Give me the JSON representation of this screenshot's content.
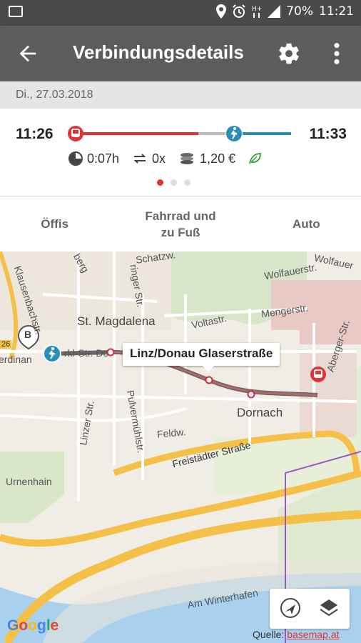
{
  "status_bar": {
    "battery": "70%",
    "time": "11:21",
    "icons": [
      "image-icon",
      "location-icon",
      "alarm-icon",
      "network-hplus-icon",
      "signal-icon"
    ]
  },
  "app_bar": {
    "title": "Verbindungsdetails",
    "icons": [
      "back-arrow-icon",
      "gear-icon",
      "more-vert-icon"
    ]
  },
  "date": "Di., 27.03.2018",
  "connection": {
    "departure": "11:26",
    "arrival": "11:33",
    "duration": "0:07h",
    "transfers": "0x",
    "price": "1,20 €",
    "icons": [
      "tram-icon",
      "walk-icon",
      "clock-icon",
      "transfer-icon",
      "coins-icon",
      "leaf-icon"
    ],
    "page_count": 3,
    "active_page": 0,
    "colors": {
      "tram": "#e03535",
      "walk": "#2a8fb8",
      "leaf": "#3aa845"
    }
  },
  "tabs": [
    {
      "label_lines": [
        "Öffis"
      ]
    },
    {
      "label_lines": [
        "Fahrrad und",
        "zu Fuß"
      ]
    },
    {
      "label_lines": [
        "Auto"
      ]
    }
  ],
  "map": {
    "callout": "Linz/Donau Glaserstraße",
    "labels": {
      "st_magdalena": "St. Magdalena",
      "dornach": "Dornach",
      "voltastr": "Voltastr.",
      "mengerstr": "Mengerstr.",
      "wolfauerstr": "Wolfauerstr.",
      "wolfauer2": "Wolfauer",
      "schatzw": "Schatzw.",
      "ringer": "ringer Str.",
      "klausenbachstr": "Klausenbachstr.",
      "linzer": "Linzer Str.",
      "pulvermuehl": "Pulvermühlstr.",
      "feldw": "Feldw.",
      "freistaedter": "Freistädter Straße",
      "urnenhain": "Urnenhain",
      "winterhafen": "Am Winterhafen",
      "berg": "berg",
      "erdinan": "erdinan",
      "marklstr": "rkl-Str. Do",
      "nummer": "26",
      "aberger": "Aberger-Str.",
      "b_marker": "B"
    },
    "source_prefix": "Quelle:",
    "source_link": "basemap.at",
    "google": [
      "G",
      "o",
      "o",
      "g",
      "l",
      "e"
    ],
    "control_icons": [
      "navigation-icon",
      "layers-icon"
    ]
  }
}
